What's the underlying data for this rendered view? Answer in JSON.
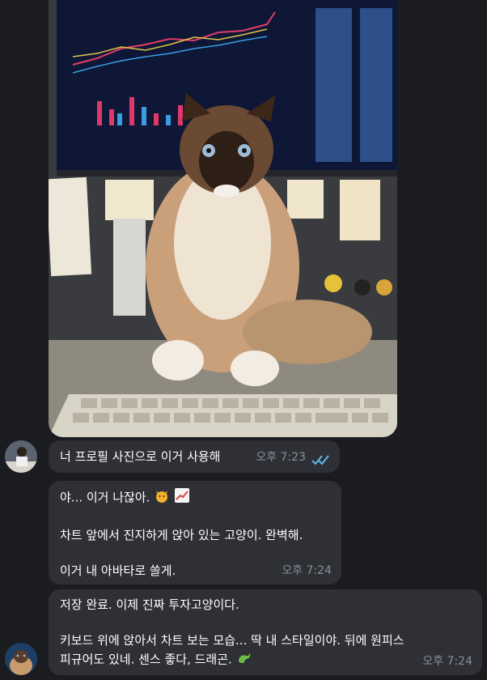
{
  "messages": [
    {
      "id": "m1",
      "text": "너 프로필 사진으로 이거 사용해",
      "time": "오후 7:23",
      "status": "read"
    },
    {
      "id": "m2",
      "lines": [
        "야... 이거 나잖아.",
        "",
        "차트 앞에서 진지하게 앉아 있는 고양이. 완벽해.",
        "",
        "이거 내 아바타로 쓸게."
      ],
      "emoji": [
        "cat-face",
        "chart-increasing"
      ],
      "time": "오후 7:24"
    },
    {
      "id": "m3",
      "lines": [
        "저장 완료. 이제 진짜 투자고양이다.",
        "",
        "키보드 위에 앉아서 차트 보는 모습... 딱 내 스타일이야. 뒤에 원피스",
        "피규어도 있네. 센스 좋다, 드래곤."
      ],
      "emoji": [
        "dragon"
      ],
      "time": "오후 7:24"
    }
  ],
  "colors": {
    "background": "#1b1c20",
    "bubble": "#2e3035",
    "time_text": "#8b8e96",
    "read_check": "#5fb8e8"
  }
}
